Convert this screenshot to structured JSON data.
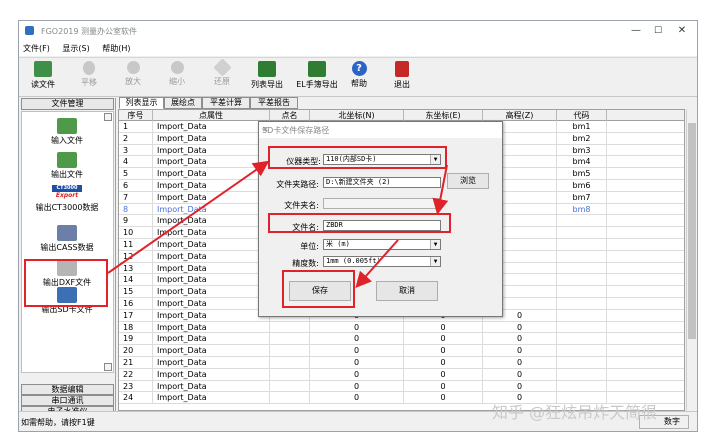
{
  "window": {
    "title": "FGO2019 测量办公室软件",
    "minimize": "—",
    "maximize": "☐",
    "close": "✕"
  },
  "menu": [
    "文件(F)",
    "显示(S)",
    "帮助(H)"
  ],
  "toolbar": [
    {
      "label": "读文件",
      "icon": "open-file-icon",
      "color": "#3f8f46"
    },
    {
      "label": "平移",
      "icon": "hand-pan-icon",
      "color": "#9a9a9a"
    },
    {
      "label": "放大",
      "icon": "zoom-in-icon",
      "color": "#9a9a9a"
    },
    {
      "label": "缩小",
      "icon": "zoom-out-icon",
      "color": "#9a9a9a"
    },
    {
      "label": "还原",
      "icon": "restore-view-icon",
      "color": "#9a9a9a"
    },
    {
      "label": "列表导出",
      "icon": "list-export-icon",
      "color": "#2e7d32"
    },
    {
      "label": "EL手簿导出",
      "icon": "el-export-icon",
      "color": "#2e7d32"
    },
    {
      "label": "帮助",
      "icon": "help-icon",
      "color": "#2b63c6"
    },
    {
      "label": "退出",
      "icon": "exit-icon",
      "color": "#c62828"
    }
  ],
  "left_panel": {
    "header": "文件管理",
    "items": [
      {
        "label": "输入文件",
        "icon": "import-file-icon"
      },
      {
        "label": "输出文件",
        "icon": "export-file-icon"
      },
      {
        "label": "输出CT3000数据",
        "icon": "ct3000-export-icon",
        "logo_top": "CT3000",
        "logo_bottom": "Export"
      },
      {
        "label": "输出CASS数据",
        "icon": "cass-export-icon"
      },
      {
        "label": "输出DXF文件",
        "icon": "dxf-export-icon"
      },
      {
        "label": "输出SD卡文件",
        "icon": "sd-card-export-icon"
      }
    ],
    "bottom_buttons": [
      "数据编辑",
      "串口通讯",
      "电子水准仪",
      "工具"
    ]
  },
  "tabs": [
    "列表显示",
    "展绘点",
    "平差计算",
    "平差报告"
  ],
  "table": {
    "columns": [
      "序号",
      "点属性",
      "点名",
      "北坐标(N)",
      "东坐标(E)",
      "高程(Z)",
      "代码"
    ],
    "rows": [
      [
        "1",
        "Import_Data",
        "",
        "",
        "",
        "",
        "bm1"
      ],
      [
        "2",
        "Import_Data",
        "",
        "",
        "",
        "",
        "bm2"
      ],
      [
        "3",
        "Import_Data",
        "",
        "",
        "",
        "",
        "bm3"
      ],
      [
        "4",
        "Import_Data",
        "",
        "",
        "",
        "",
        "bm4"
      ],
      [
        "5",
        "Import_Data",
        "",
        "",
        "",
        "",
        "bm5"
      ],
      [
        "6",
        "Import_Data",
        "",
        "",
        "",
        "",
        "bm6"
      ],
      [
        "7",
        "Import_Data",
        "",
        "",
        "",
        "",
        "bm7"
      ],
      [
        "8",
        "Import_Data",
        "",
        "",
        "",
        "",
        "bm8"
      ],
      [
        "9",
        "Import_Data",
        "",
        "",
        "",
        "",
        ""
      ],
      [
        "10",
        "Import_Data",
        "",
        "",
        "",
        "",
        ""
      ],
      [
        "11",
        "Import_Data",
        "",
        "",
        "",
        "",
        ""
      ],
      [
        "12",
        "Import_Data",
        "",
        "",
        "",
        "",
        ""
      ],
      [
        "13",
        "Import_Data",
        "",
        "",
        "",
        "",
        ""
      ],
      [
        "14",
        "Import_Data",
        "",
        "",
        "",
        "",
        ""
      ],
      [
        "15",
        "Import_Data",
        "",
        "",
        "",
        "",
        ""
      ],
      [
        "16",
        "Import_Data",
        "",
        "",
        "",
        "",
        ""
      ],
      [
        "17",
        "Import_Data",
        "",
        "0",
        "0",
        "0",
        ""
      ],
      [
        "18",
        "Import_Data",
        "",
        "0",
        "0",
        "0",
        ""
      ],
      [
        "19",
        "Import_Data",
        "",
        "0",
        "0",
        "0",
        ""
      ],
      [
        "20",
        "Import_Data",
        "",
        "0",
        "0",
        "0",
        ""
      ],
      [
        "21",
        "Import_Data",
        "",
        "0",
        "0",
        "0",
        ""
      ],
      [
        "22",
        "Import_Data",
        "",
        "0",
        "0",
        "0",
        ""
      ],
      [
        "23",
        "Import_Data",
        "",
        "0",
        "0",
        "0",
        ""
      ],
      [
        "24",
        "Import_Data",
        "",
        "0",
        "0",
        "0",
        ""
      ]
    ],
    "highlighted_row": "8"
  },
  "dialog": {
    "title": "SD卡文件保存路径",
    "close": "✕",
    "instrument_label": "仪器类型:",
    "instrument_value": "110(内部SD卡)",
    "folder_path_label": "文件夹路径:",
    "folder_path_value": "D:\\新建文件夹 (2)",
    "browse": "浏览",
    "folder_name_label": "文件夹名:",
    "folder_name_value": "",
    "file_name_label": "文件名:",
    "file_name_value": "ZBDR",
    "unit_label": "单位:",
    "unit_value": "米 (m)",
    "precision_label": "精度数:",
    "precision_value": "1mm (0.005ft)",
    "save": "保存",
    "cancel": "取消"
  },
  "status": {
    "help_text": "如需帮助，请按F1键",
    "indicator": "数字"
  },
  "watermark": "知乎 @狂炫吊炸天简很",
  "colors": {
    "annotation_red": "#e0222a",
    "highlight_blue": "#4a6fd8"
  }
}
